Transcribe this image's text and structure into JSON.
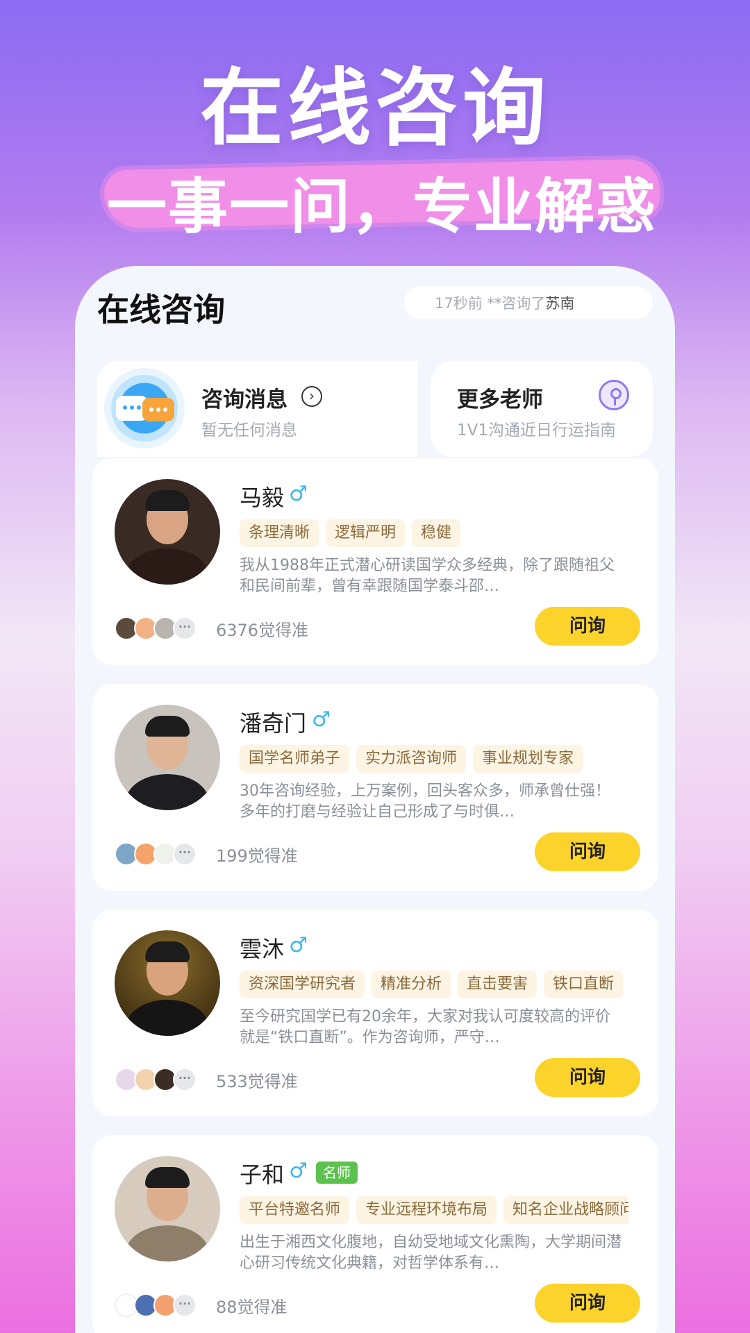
{
  "hero": {
    "title": "在线咨询",
    "subtitle": "一事一问，专业解惑"
  },
  "panel": {
    "title": "在线咨询",
    "ticker_time": "17秒前",
    "ticker_text": "**咨询了",
    "ticker_name": "苏南"
  },
  "messages": {
    "title": "咨询消息",
    "arrow_icon": "chevron-right-circle-icon",
    "subtitle": "暂无任何消息"
  },
  "more_teachers": {
    "title": "更多老师",
    "subtitle": "1V1沟通近日行运指南",
    "icon": "microphone-icon"
  },
  "teachers": [
    {
      "name": "马毅",
      "gender": "♂",
      "badge": "",
      "tags": [
        "条理清晰",
        "逻辑严明",
        "稳健"
      ],
      "desc": "我从1988年正式潜心研读国学众多经典，除了跟随祖父和民间前辈，曾有幸跟随国学泰斗邵…",
      "count": "6376觉得准",
      "ask": "问询"
    },
    {
      "name": "潘奇门",
      "gender": "♂",
      "badge": "",
      "tags": [
        "国学名师弟子",
        "实力派咨询师",
        "事业规划专家"
      ],
      "desc": "30年咨询经验，上万案例，回头客众多，师承曾仕强！多年的打磨与经验让自己形成了与时俱…",
      "count": "199觉得准",
      "ask": "问询"
    },
    {
      "name": "雲沐",
      "gender": "♂",
      "badge": "",
      "tags": [
        "资深国学研究者",
        "精准分析",
        "直击要害",
        "铁口直断"
      ],
      "desc": "至今研究国学已有20余年，大家对我认可度较高的评价就是“铁口直断”。作为咨询师，严守…",
      "count": "533觉得准",
      "ask": "问询"
    },
    {
      "name": "子和",
      "gender": "♂",
      "badge": "名师",
      "tags": [
        "平台特邀名师",
        "专业远程环境布局",
        "知名企业战略顾问"
      ],
      "desc": "出生于湘西文化腹地，自幼受地域文化熏陶，大学期间潜心研习传统文化典籍，对哲学体系有…",
      "count": "88觉得准",
      "ask": "问询"
    }
  ],
  "colors": {
    "accent_button": "#fbd32a",
    "gender_male": "#3ab6f0",
    "badge_green": "#5cc24e"
  }
}
